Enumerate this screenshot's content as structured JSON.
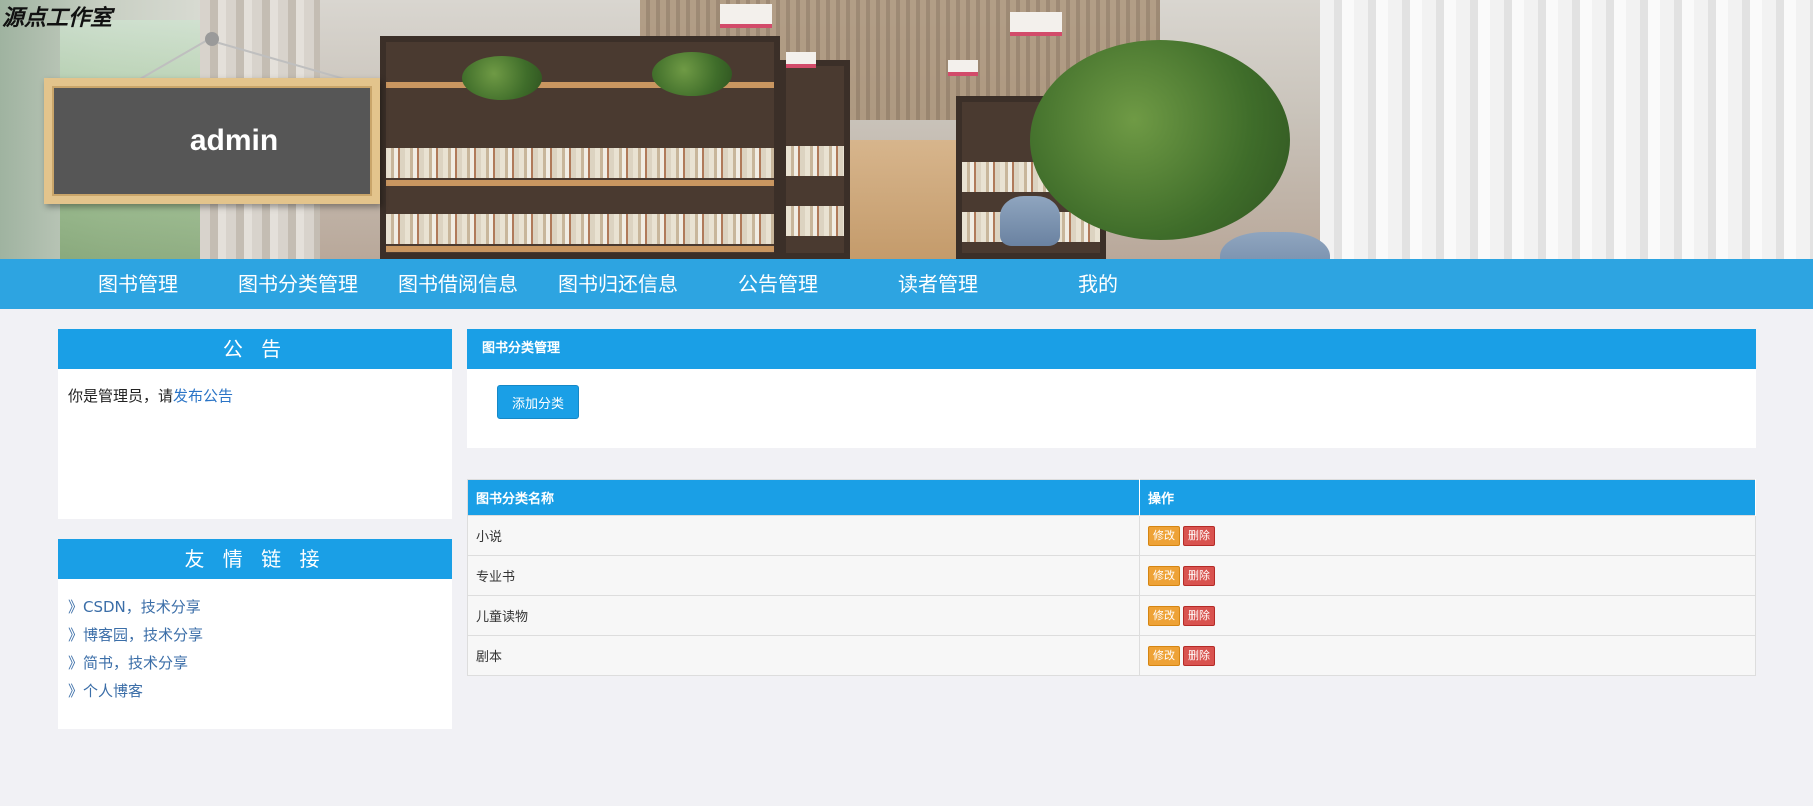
{
  "site_logo": "源点工作室",
  "board_user": "admin",
  "nav": [
    {
      "label": "图书管理"
    },
    {
      "label": "图书分类管理"
    },
    {
      "label": "图书借阅信息"
    },
    {
      "label": "图书归还信息"
    },
    {
      "label": "公告管理"
    },
    {
      "label": "读者管理"
    },
    {
      "label": "我的"
    }
  ],
  "notice": {
    "title": "公 告",
    "text": "你是管理员，请",
    "link": "发布公告"
  },
  "friend_links": {
    "title": "友 情 链 接",
    "items": [
      "》CSDN，技术分享",
      "》博客园，技术分享",
      "》简书，技术分享",
      "》个人博客"
    ]
  },
  "main": {
    "title": "图书分类管理",
    "add_button": "添加分类"
  },
  "table": {
    "headers": [
      "图书分类名称",
      "操作"
    ],
    "rows": [
      {
        "name": "小说"
      },
      {
        "name": "专业书"
      },
      {
        "name": "儿童读物"
      },
      {
        "name": "剧本"
      }
    ],
    "edit_label": "修改",
    "delete_label": "删除"
  },
  "colors": {
    "accent": "#1a9fe6",
    "edit": "#eea236",
    "delete": "#d9534f",
    "page_bg": "#f1f1f5"
  }
}
